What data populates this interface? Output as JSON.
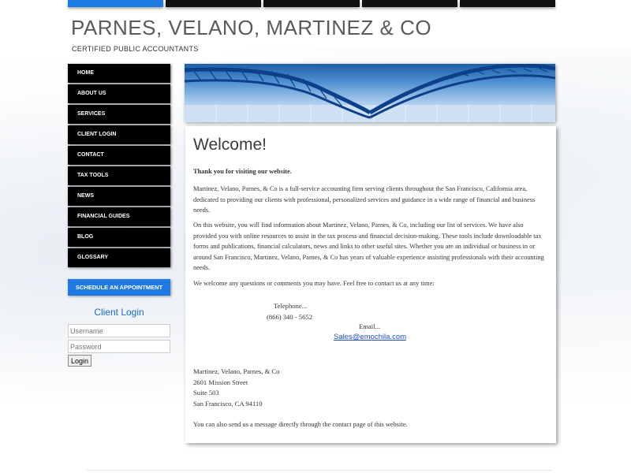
{
  "topnav_tabs": 5,
  "header": {
    "firm_name": "PARNES, VELANO, MARTINEZ & CO",
    "tagline": "CERTIFIED PUBLIC ACCOUNTANTS"
  },
  "nav": {
    "items": [
      {
        "label": "HOME"
      },
      {
        "label": "ABOUT US"
      },
      {
        "label": "SERVICES"
      },
      {
        "label": "CLIENT LOGIN"
      },
      {
        "label": "CONTACT"
      },
      {
        "label": "TAX TOOLS"
      },
      {
        "label": "NEWS"
      },
      {
        "label": "FINANCIAL GUIDES"
      },
      {
        "label": "BLOG"
      },
      {
        "label": "GLOSSARY"
      }
    ],
    "appointment_label": "SCHEDULE AN APPOINTMENT"
  },
  "login": {
    "title": "Client Login",
    "username_placeholder": "Username",
    "password_placeholder": "Password",
    "button_label": "Login"
  },
  "content": {
    "heading": "Welcome!",
    "intro": "Thank you for visiting our website.",
    "para1": "Martinez, Velano, Parnes, & Co is a full-service accounting firm serving clients throughout the San Francisco, California area, dedicated to providing our clients with professional, personalized services and guidance in a wide range of financial and business needs.",
    "para2": "On this website, you will find information about Martinez, Velano, Parnes, & Co, including our list of services. We have also provided you with online resources to assist in the tax process and financial decision-making. These tools include downloadable tax forms and publications, financial calculators, news and links to other useful sites. Whether you are an individual or business in or around San Francisco, Martinez, Velano, Parnes, & Co has years of valuable experience assisting professionals with their accounting needs.",
    "para3": "We welcome any questions or comments you may have. Feel free to contact us at any time:",
    "telephone_label": "Telephone...",
    "telephone": "(866) 340 - 5652",
    "email_label": "Email...",
    "email": "Sales@emochila.com",
    "address": {
      "line1": "Martinez, Velano, Parnes, & Co",
      "line2": "2601 Mission Street",
      "line3": "Suite 503",
      "line4": "San Francisco, CA 94110"
    },
    "closing": "You can also send us a message directly through the contact page of this website."
  },
  "colors": {
    "accent": "#1e7ae0",
    "nav_bg": "#000000",
    "link": "#1f4fbf"
  }
}
